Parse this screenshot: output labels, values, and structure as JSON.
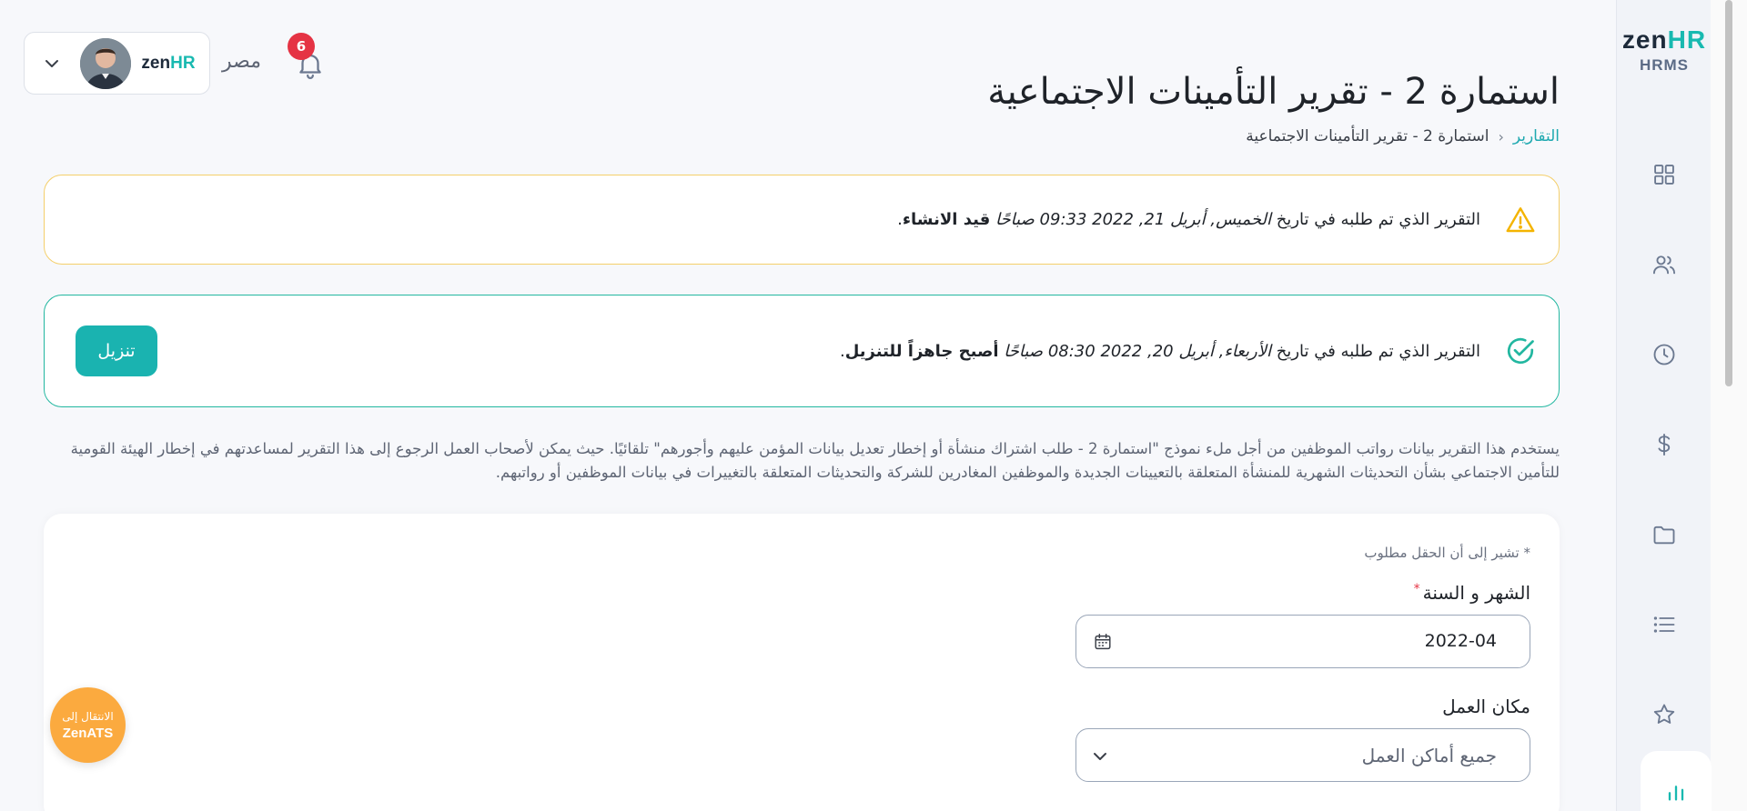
{
  "sidebar": {
    "logo_main": "zen",
    "logo_accent": "HR",
    "logo_sub": "HRMS",
    "items": [
      {
        "icon": "dashboard-grid-icon"
      },
      {
        "icon": "users-icon"
      },
      {
        "icon": "clock-icon"
      },
      {
        "icon": "dollar-icon"
      },
      {
        "icon": "folder-icon"
      },
      {
        "icon": "list-icon"
      },
      {
        "icon": "star-icon"
      },
      {
        "icon": "bar-chart-icon",
        "active": true
      }
    ]
  },
  "header": {
    "notifications_count": "6",
    "country": "مصر",
    "company_logo_main": "zen",
    "company_logo_accent": "HR"
  },
  "page": {
    "title": "استمارة 2 - تقرير التأمينات الاجتماعية",
    "breadcrumb": {
      "parent": "التقارير",
      "current": "استمارة 2 - تقرير التأمينات الاجتماعية"
    }
  },
  "alerts": {
    "pending": {
      "prefix": "التقرير الذي تم طلبه في تاريخ ",
      "date": "الخميس, أبريل 21, 2022 09:33 صباحًا",
      "status": "قيد الانشاء",
      "suffix": "."
    },
    "ready": {
      "prefix": "التقرير الذي تم طلبه في تاريخ ",
      "date": "الأربعاء, أبريل 20, 2022 08:30 صباحًا",
      "status": "أصبح جاهزاً للتنزيل",
      "suffix": ".",
      "download_label": "تنزيل"
    }
  },
  "description": "يستخدم هذا التقرير بيانات رواتب الموظفين من أجل ملء نموذج \"استمارة 2 - طلب اشتراك منشأة أو إخطار تعديل بيانات المؤمن عليهم وأجورهم\" تلقائيًا. حيث يمكن لأصحاب العمل الرجوع إلى هذا التقرير لمساعدتهم في إخطار الهيئة القومية للتأمين الاجتماعي بشأن التحديثات الشهرية للمنشأة المتعلقة بالتعيينات الجديدة والموظفين المغادرين للشركة والتحديثات المتعلقة بالتغييرات في بيانات الموظفين أو رواتبهم.",
  "form": {
    "required_note": "* تشير إلى أن الحقل مطلوب",
    "month_year": {
      "label": "الشهر و السنة",
      "required_mark": "*",
      "value": "2022-04"
    },
    "work_location": {
      "label": "مكان العمل",
      "value": "جميع أماكن العمل"
    }
  },
  "fab": {
    "line1": "الانتقال إلى",
    "line2": "ZenATS"
  },
  "colors": {
    "accent": "#1ab3b0",
    "warning": "#f4b400",
    "success": "#22b7a0",
    "badge": "#e53344",
    "fab": "#fbaa3f"
  }
}
